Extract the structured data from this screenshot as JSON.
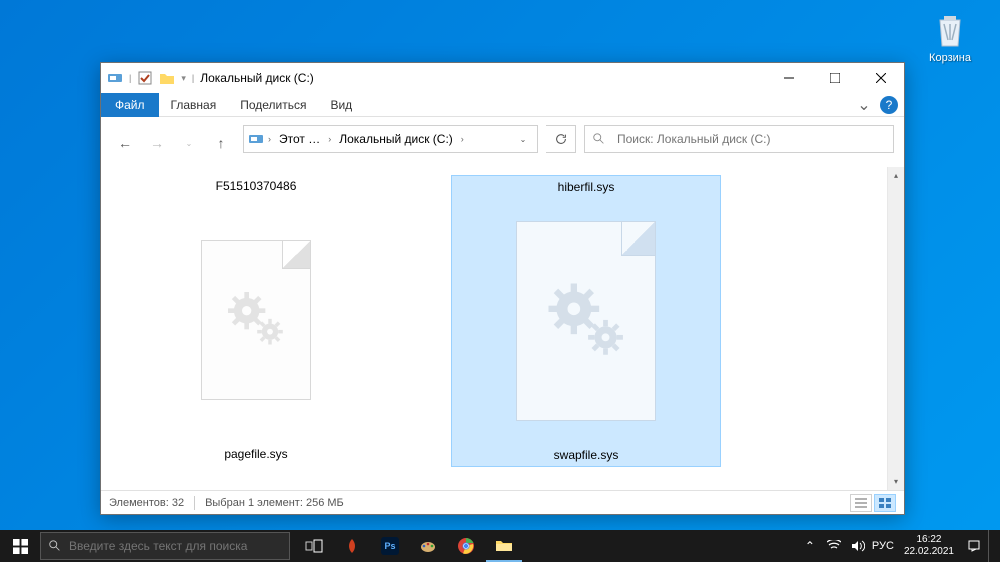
{
  "desktop": {
    "recycle_label": "Корзина"
  },
  "window": {
    "title": "Локальный диск (C:)",
    "ribbon": {
      "file": "Файл",
      "home": "Главная",
      "share": "Поделиться",
      "view": "Вид"
    },
    "breadcrumb": {
      "pc": "Этот …",
      "drive": "Локальный диск (C:)"
    },
    "search_placeholder": "Поиск: Локальный диск (C:)",
    "files": [
      {
        "top": "F51510370486",
        "bottom": "pagefile.sys",
        "selected": false
      },
      {
        "top": "hiberfil.sys",
        "bottom": "swapfile.sys",
        "selected": true
      }
    ],
    "status": {
      "count": "Элементов: 32",
      "selected": "Выбран 1 элемент: 256 МБ"
    }
  },
  "taskbar": {
    "search_placeholder": "Введите здесь текст для поиска",
    "lang": "РУС",
    "time": "16:22",
    "date": "22.02.2021"
  }
}
